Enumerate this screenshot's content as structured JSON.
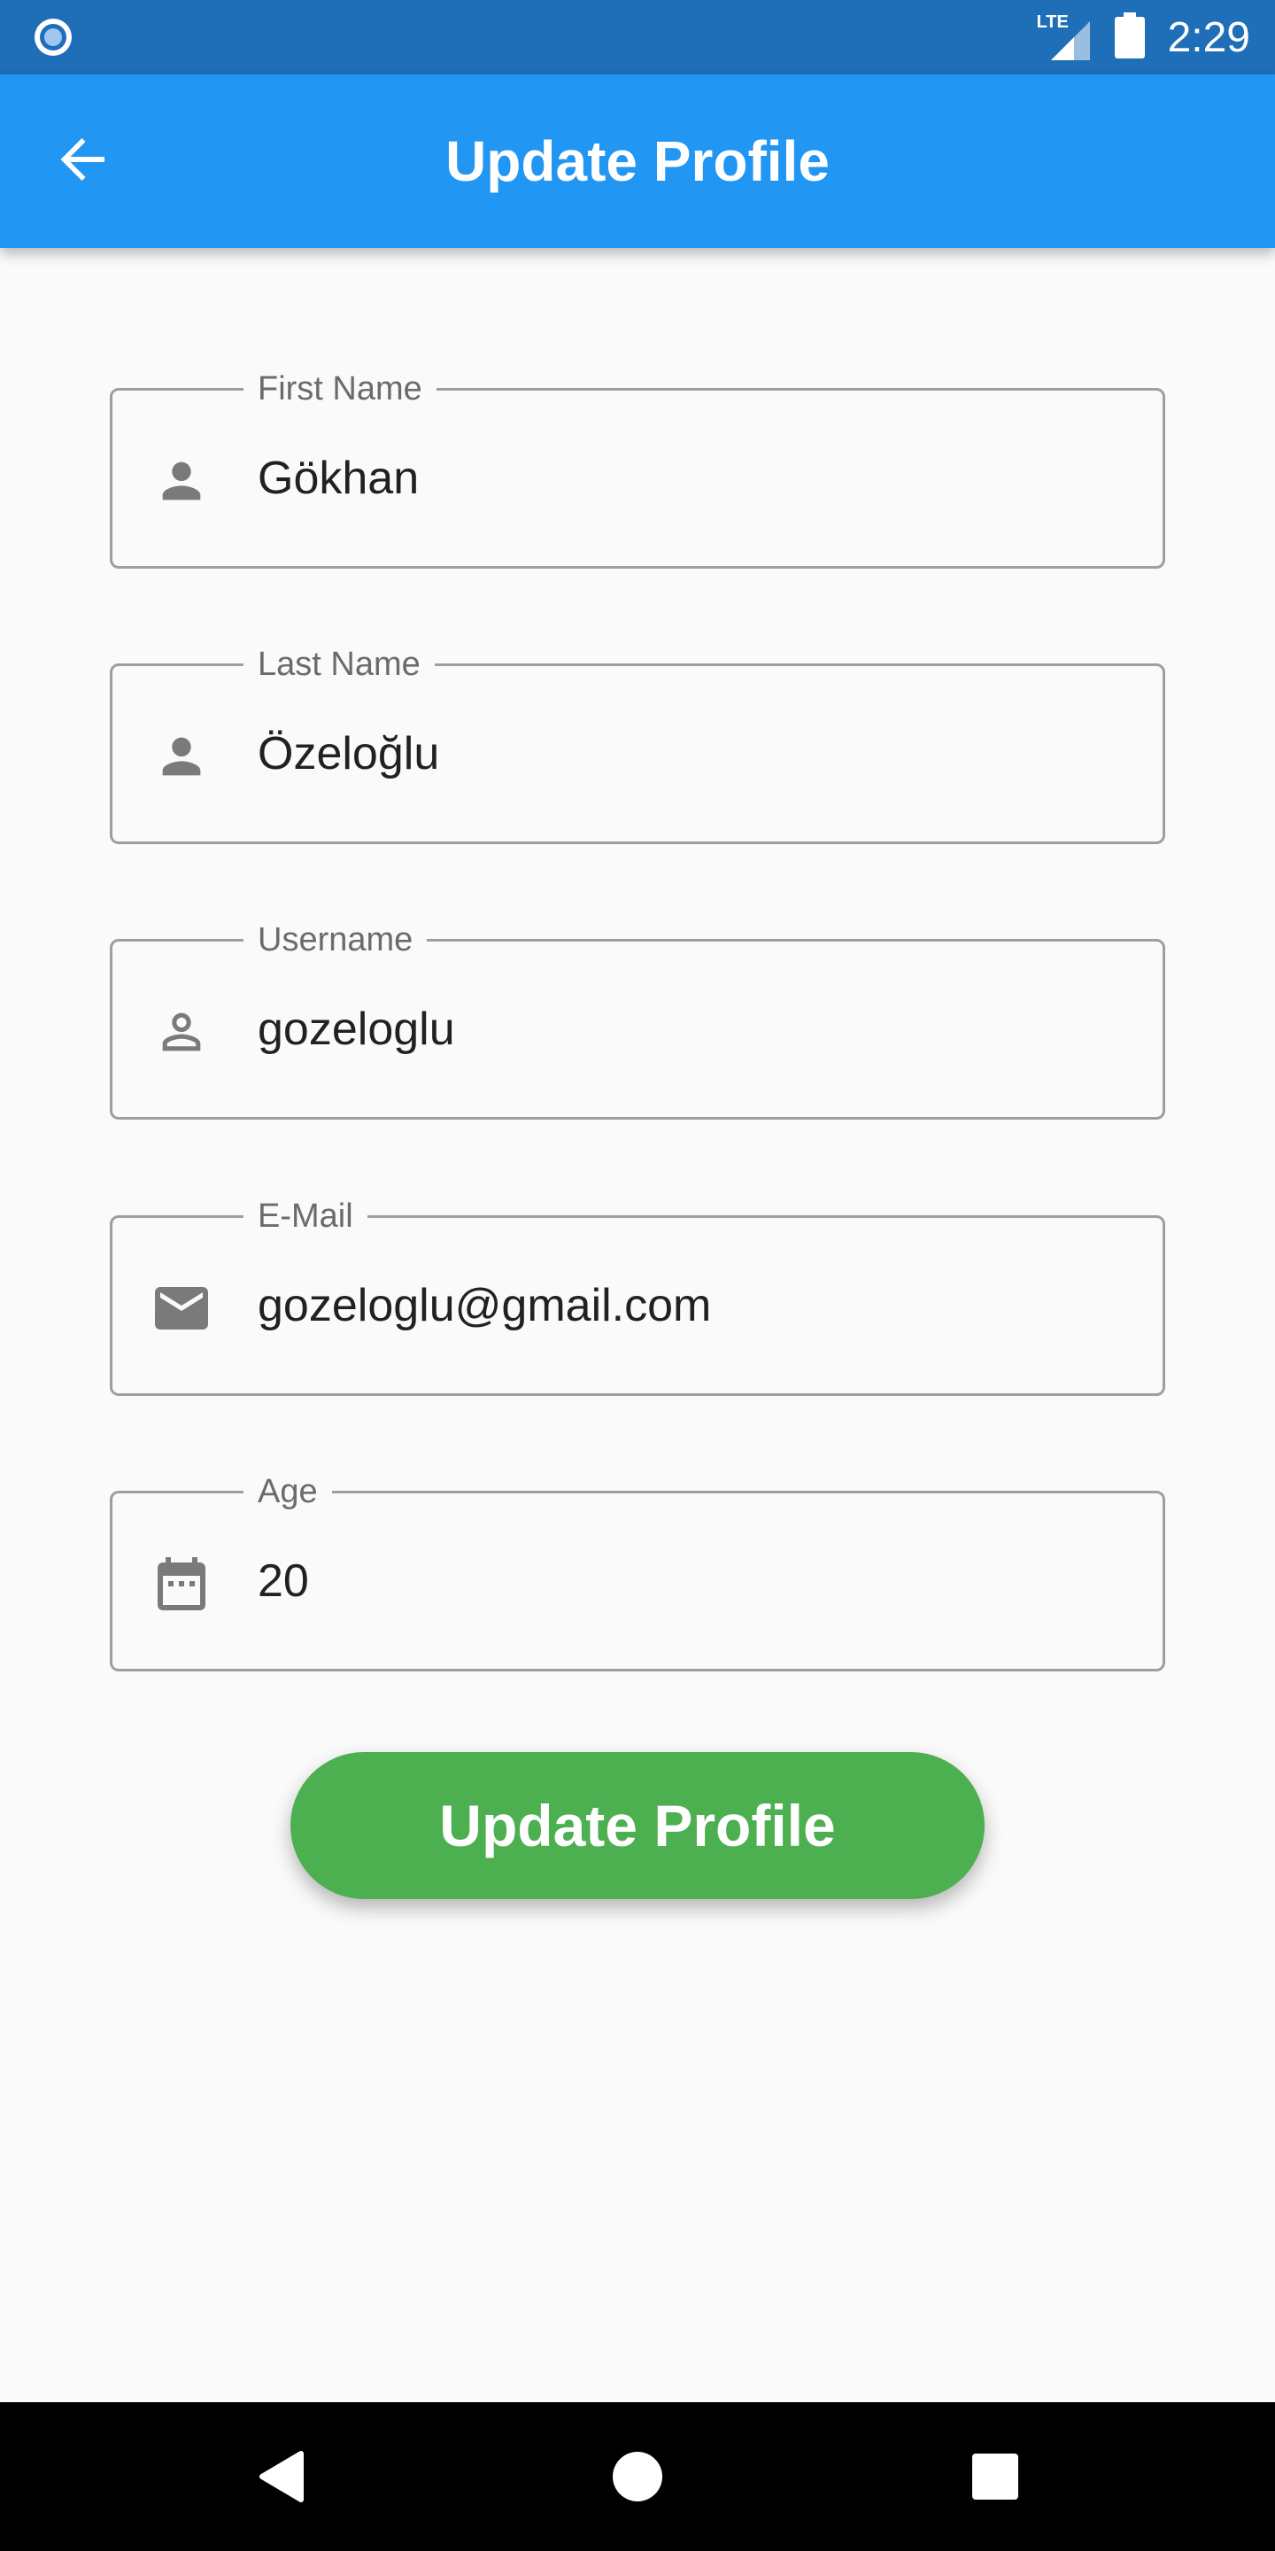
{
  "status_bar": {
    "network": "LTE",
    "time": "2:29"
  },
  "app_bar": {
    "title": "Update Profile",
    "back_icon": "arrow-back-icon"
  },
  "form": {
    "fields": [
      {
        "label": "First Name",
        "value": "Gökhan",
        "icon": "person-icon"
      },
      {
        "label": "Last Name",
        "value": "Özeloğlu",
        "icon": "person-icon"
      },
      {
        "label": "Username",
        "value": "gozeloglu",
        "icon": "person-outline-icon"
      },
      {
        "label": "E-Mail",
        "value": "gozeloglu@gmail.com",
        "icon": "mail-icon"
      },
      {
        "label": "Age",
        "value": "20",
        "icon": "calendar-icon"
      }
    ],
    "submit_label": "Update Profile"
  },
  "colors": {
    "status_bar": "#1e6fb8",
    "app_bar": "#2196f3",
    "button": "#4caf50",
    "background": "#fafafa"
  },
  "nav_bar": {
    "icons": [
      "back-triangle-icon",
      "home-circle-icon",
      "recents-square-icon"
    ]
  }
}
